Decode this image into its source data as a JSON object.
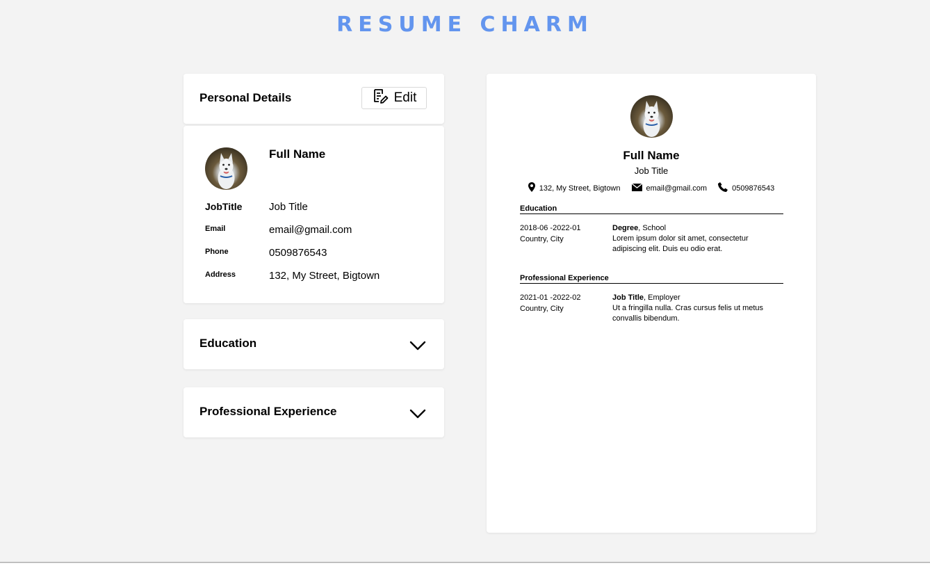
{
  "app": {
    "title": "RESUME CHARM"
  },
  "colors": {
    "accent": "#6395ee",
    "background": "#f3f3f3"
  },
  "personal": {
    "header_title": "Personal Details",
    "edit_label": "Edit",
    "edit_icon": "edit-note-icon",
    "full_name": "Full Name",
    "avatar_alt": "husky dog photo",
    "fields": [
      {
        "label": "JobTitle",
        "value": "Job Title"
      },
      {
        "label": "Email",
        "value": "email@gmail.com"
      },
      {
        "label": "Phone",
        "value": "0509876543"
      },
      {
        "label": "Address",
        "value": "132, My Street, Bigtown"
      }
    ]
  },
  "sections": {
    "education_title": "Education",
    "experience_title": "Professional Experience",
    "expand_icon": "chevron-down-icon"
  },
  "preview": {
    "name": "Full Name",
    "job_title": "Job Title",
    "address": "132, My Street, Bigtown",
    "email": "email@gmail.com",
    "phone": "0509876543",
    "education": {
      "title": "Education",
      "date": "2018-06 -2022-01",
      "location": "Country, City",
      "degree": "Degree",
      "school": ", School",
      "description": "Lorem ipsum dolor sit amet, consectetur adipiscing elit. Duis eu odio erat."
    },
    "experience": {
      "title": "Professional Experience",
      "date": "2021-01 -2022-02",
      "location": "Country, City",
      "role": "Job Title",
      "employer": ", Employer",
      "description": "Ut a fringilla nulla. Cras cursus felis ut metus convallis bibendum."
    }
  }
}
